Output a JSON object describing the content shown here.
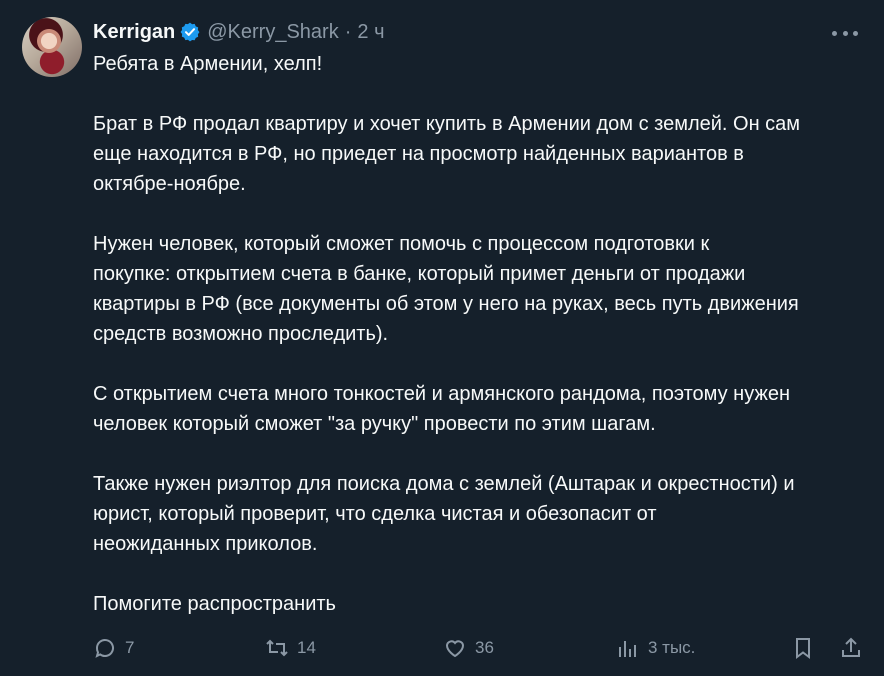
{
  "tweet": {
    "author_name": "Kerrigan",
    "handle": "@Kerry_Shark",
    "separator": "·",
    "time": "2 ч",
    "paragraphs": [
      "Ребята в Армении, хелп!",
      "Брат в РФ продал квартиру и хочет купить в Армении дом с землей. Он сам\nеще находится в РФ, но приедет на просмотр найденных вариантов в\nоктябре-ноябре.",
      "Нужен человек, который сможет помочь с процессом подготовки к\nпокупке: открытием счета в банке, который примет деньги от продажи\nквартиры в РФ (все документы об этом у него на руках, весь путь движения\nсредств возможно проследить).",
      "С открытием счета много тонкостей и армянского рандома, поэтому нужен\nчеловек который сможет \"за ручку\" провести по этим шагам.",
      "Также нужен риэлтор для поиска дома с землей (Аштарак и окрестности) и\nюрист, который проверит, что сделка чистая и обезопасит от\nнеожиданных приколов.",
      "Помогите распространить"
    ],
    "stats": {
      "replies": "7",
      "retweets": "14",
      "likes": "36",
      "views": "3 тыс."
    }
  },
  "icons": {
    "verified": "verified-badge-icon",
    "more": "more-icon",
    "reply": "reply-icon",
    "retweet": "retweet-icon",
    "like": "heart-icon",
    "views": "views-chart-icon",
    "bookmark": "bookmark-icon",
    "share": "share-icon"
  },
  "colors": {
    "background": "#15202b",
    "text": "#f7f9f9",
    "muted": "#8b98a5",
    "verified": "#1d9bf0"
  }
}
